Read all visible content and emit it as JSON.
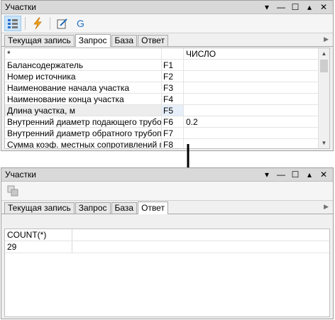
{
  "panel1": {
    "title": "Участки",
    "tabs": [
      "Текущая запись",
      "Запрос",
      "База",
      "Ответ"
    ],
    "active_tab": 1,
    "header": {
      "col_name": "*",
      "col_value": "ЧИСЛО"
    },
    "rows": [
      {
        "name": "Балансодержатель",
        "field": "F1",
        "value": ""
      },
      {
        "name": "Номер источника",
        "field": "F2",
        "value": ""
      },
      {
        "name": "Наименование начала участка",
        "field": "F3",
        "value": ""
      },
      {
        "name": "Наименование конца участка",
        "field": "F4",
        "value": ""
      },
      {
        "name": "Длина участка, м",
        "field": "F5",
        "value": ""
      },
      {
        "name": "Внутренний диаметр подающего трубоп...",
        "field": "F6",
        "value": "0.2"
      },
      {
        "name": "Внутренний диаметр обратного трубопр...",
        "field": "F7",
        "value": ""
      },
      {
        "name": "Сумма коэф. местных сопротивлений п...",
        "field": "F8",
        "value": ""
      }
    ]
  },
  "panel2": {
    "title": "Участки",
    "tabs": [
      "Текущая запись",
      "Запрос",
      "База",
      "Ответ"
    ],
    "active_tab": 3,
    "result_header": "COUNT(*)",
    "result_value": "29"
  },
  "colors": {
    "title_bg": "#d9d9d9",
    "accent": "#1e6fc0"
  }
}
